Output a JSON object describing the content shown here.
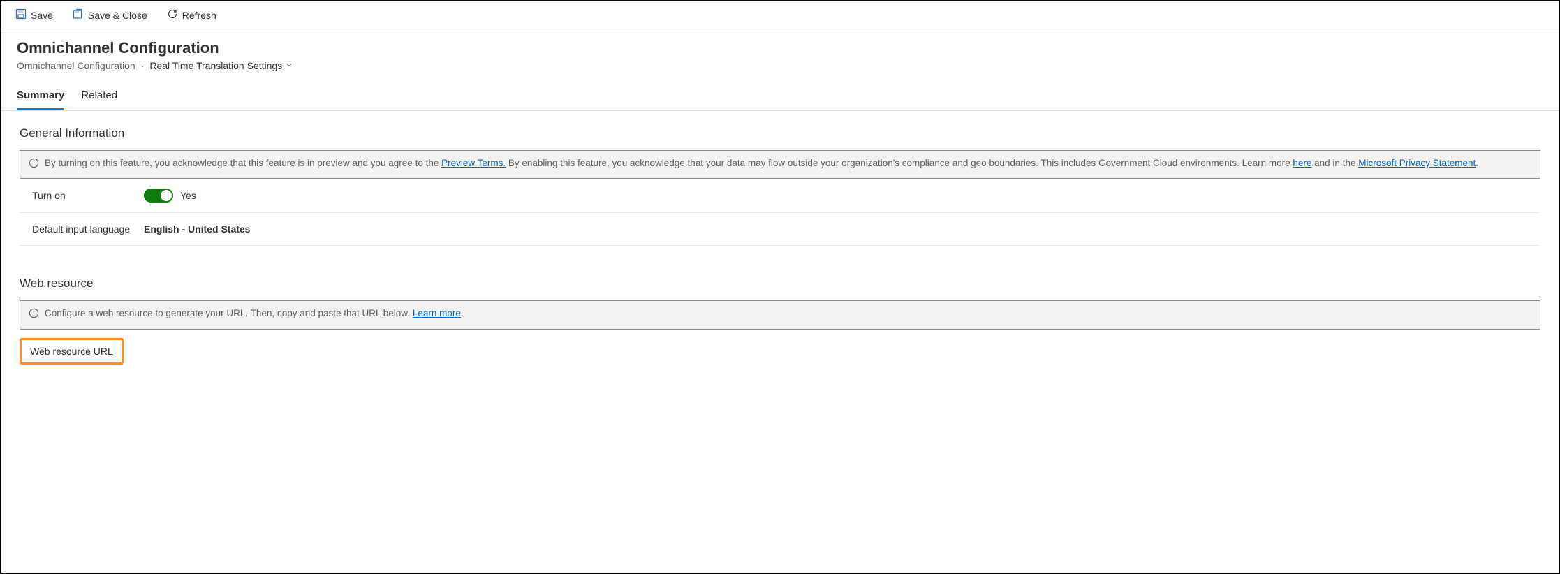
{
  "toolbar": {
    "save": "Save",
    "save_close": "Save & Close",
    "refresh": "Refresh"
  },
  "header": {
    "title": "Omnichannel Configuration",
    "breadcrumb_entity": "Omnichannel Configuration",
    "breadcrumb_form": "Real Time Translation Settings"
  },
  "tabs": {
    "summary": "Summary",
    "related": "Related"
  },
  "section_general": {
    "title": "General Information",
    "banner_pre": "By turning on this feature, you acknowledge that this feature is in preview and you agree to the ",
    "banner_link1": "Preview Terms.",
    "banner_mid": " By enabling this feature, you acknowledge that your data may flow outside your organization's compliance and geo boundaries. This includes Government Cloud environments. Learn more ",
    "banner_link2": "here",
    "banner_mid2": " and in the ",
    "banner_link3": "Microsoft Privacy Statement",
    "banner_end": ".",
    "turn_on_label": "Turn on",
    "turn_on_value": "Yes",
    "default_lang_label": "Default input language",
    "default_lang_value": "English - United States"
  },
  "section_web": {
    "title": "Web resource",
    "banner_text": "Configure a web resource to generate your URL. Then, copy and paste that URL below. ",
    "banner_link": "Learn more",
    "banner_end": ".",
    "url_label": "Web resource URL"
  }
}
